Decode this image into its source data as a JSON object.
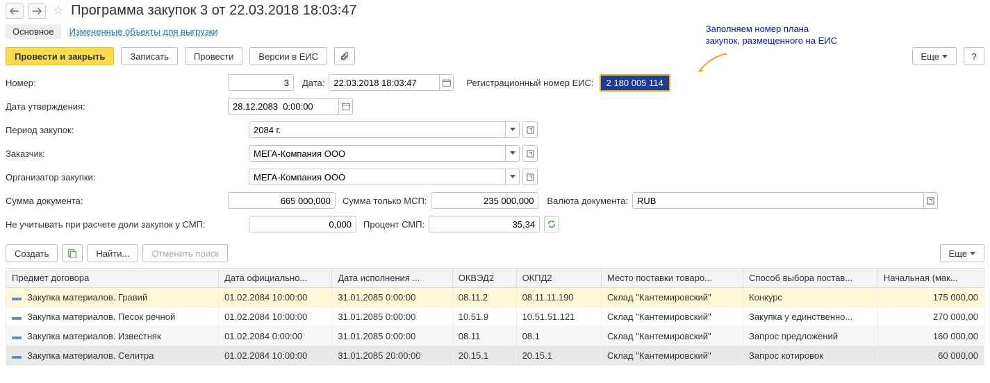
{
  "header": {
    "title": "Программа закупок 3 от 22.03.2018 18:03:47"
  },
  "tabs": {
    "main": "Основное",
    "changed": "Измененные объекты для выгрузки"
  },
  "toolbar": {
    "post_close": "Провести и закрыть",
    "save": "Записать",
    "post": "Провести",
    "versions": "Версии в ЕИС",
    "more": "Еще",
    "help": "?"
  },
  "annotation": {
    "line1": "Заполняем номер плана",
    "line2": "закупок, размещенного на ЕИС"
  },
  "form": {
    "number_label": "Номер:",
    "number_value": "3",
    "date_label": "Дата:",
    "date_value": "22.03.2018 18:03:47",
    "reg_eis_label": "Регистрационный номер ЕИС:",
    "reg_eis_value": "2 180 005 114",
    "approval_date_label": "Дата утверждения:",
    "approval_date_value": "28.12.2083  0:00:00",
    "period_label": "Период закупок:",
    "period_value": "2084 г.",
    "customer_label": "Заказчик:",
    "customer_value": "МЕГА-Компания ООО",
    "organizer_label": "Организатор закупки:",
    "organizer_value": "МЕГА-Компания ООО",
    "doc_sum_label": "Сумма документа:",
    "doc_sum_value": "665 000,000",
    "msp_sum_label": "Сумма только МСП:",
    "msp_sum_value": "235 000,000",
    "currency_label": "Валюта документа:",
    "currency_value": "RUB",
    "smp_exclude_label": "Не учитывать при расчете доли закупок у СМП:",
    "smp_exclude_value": "0,000",
    "smp_percent_label": "Процент СМП:",
    "smp_percent_value": "35,34"
  },
  "table_toolbar": {
    "create": "Создать",
    "find": "Найти...",
    "cancel_search": "Отменить поиск",
    "more": "Еще"
  },
  "table": {
    "headers": {
      "subject": "Предмет договора",
      "date_official": "Дата официально...",
      "date_exec": "Дата исполнения ...",
      "okved2": "ОКВЭД2",
      "okpd2": "ОКПД2",
      "place": "Место поставки товаро...",
      "method": "Способ выбора постав...",
      "initial_price": "Начальная (мак..."
    },
    "rows": [
      {
        "subject": "Закупка материалов. Гравий",
        "date_official": "01.02.2084 10:00:00",
        "date_exec": "31.01.2085 0:00:00",
        "okved2": "08.11.2",
        "okpd2": "08.11.11.190",
        "place": "Склад \"Кантемировский\"",
        "method": "Конкурс",
        "price": "175 000,00"
      },
      {
        "subject": "Закупка материалов. Песок речной",
        "date_official": "01.02.2084 10:00:00",
        "date_exec": "31.01.2085 0:00:00",
        "okved2": "10.51.9",
        "okpd2": "10.51.51.121",
        "place": "Склад \"Кантемировский\"",
        "method": "Закупка у единственно...",
        "price": "270 000,00"
      },
      {
        "subject": "Закупка материалов. Известняк",
        "date_official": "01.02.2084 0:00:00",
        "date_exec": "31.01.2085 0:00:00",
        "okved2": "08.11",
        "okpd2": "08.1",
        "place": "Склад \"Кантемировский\"",
        "method": "Запрос предложений",
        "price": "160 000,00"
      },
      {
        "subject": "Закупка материалов. Селитра",
        "date_official": "01.02.2084 10:00:00",
        "date_exec": "31.01.2085 20:00:00",
        "okved2": "20.15.1",
        "okpd2": "20.15.1",
        "place": "Склад \"Кантемировский\"",
        "method": "Запрос котировок",
        "price": "60 000,00"
      }
    ]
  }
}
